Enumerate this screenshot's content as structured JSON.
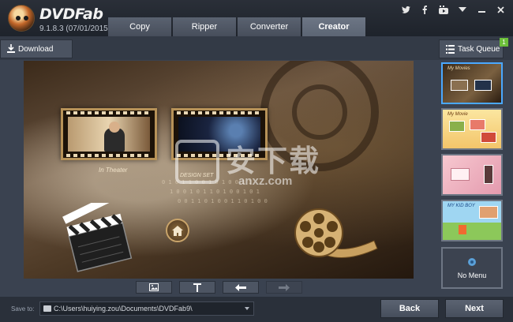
{
  "app": {
    "brand": "DVDFab",
    "version": "9.1.8.3 (07/01/2015)"
  },
  "tabs": [
    {
      "label": "Copy",
      "active": false
    },
    {
      "label": "Ripper",
      "active": false
    },
    {
      "label": "Converter",
      "active": false
    },
    {
      "label": "Creator",
      "active": true
    }
  ],
  "window_icons": [
    "twitter-icon",
    "facebook-icon",
    "youtube-icon",
    "dropdown-icon",
    "minimize-icon",
    "close-icon"
  ],
  "toolbar": {
    "download_label": "Download",
    "task_queue_label": "Task Queue",
    "task_queue_count": "1"
  },
  "preview": {
    "frame_label_1": "In Theater",
    "watermark_main": "安下载",
    "watermark_url": "anxz.com",
    "watermark_small": "DESIGN SET"
  },
  "edit_toolbar": [
    {
      "name": "background-image-button",
      "icon": "image-icon",
      "enabled": true
    },
    {
      "name": "text-button",
      "icon": "text-icon",
      "enabled": true
    },
    {
      "name": "previous-page-button",
      "icon": "arrow-left-icon",
      "enabled": true
    },
    {
      "name": "next-page-button",
      "icon": "arrow-right-icon",
      "enabled": false
    }
  ],
  "menu_templates": [
    {
      "name": "template-film-reel",
      "title": "My Movies",
      "selected": true
    },
    {
      "name": "template-party",
      "title": "My Movie",
      "selected": false
    },
    {
      "name": "template-pink",
      "title": "",
      "selected": false
    },
    {
      "name": "template-kids",
      "title": "MY KID BOY",
      "selected": false
    }
  ],
  "no_menu_label": "No Menu",
  "footer": {
    "save_to_label": "Save to:",
    "save_path": "C:\\Users\\huiying.zou\\Documents\\DVDFab9\\",
    "back_label": "Back",
    "next_label": "Next"
  },
  "colors": {
    "accent_selected": "#4aa8ff",
    "badge": "#6cbf3a",
    "background": "#3a4250"
  }
}
